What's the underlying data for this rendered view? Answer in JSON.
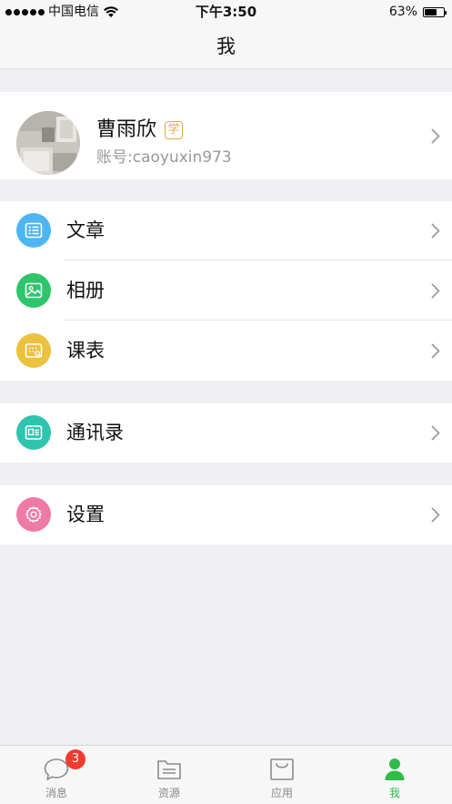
{
  "status_bar": {
    "carrier": "中国电信",
    "time": "下午3:50",
    "battery": "63%",
    "battery_level": 0.63
  },
  "nav": {
    "title": "我"
  },
  "profile": {
    "name": "曹雨欣",
    "role_badge": "学",
    "account": "账号:caoyuxin973"
  },
  "menu": {
    "articles": {
      "label": "文章",
      "icon": "article-icon",
      "color": "#4db5f2"
    },
    "album": {
      "label": "相册",
      "icon": "photo-album-icon",
      "color": "#2dc66b"
    },
    "schedule": {
      "label": "课表",
      "icon": "schedule-icon",
      "color": "#ecc13e"
    },
    "contacts": {
      "label": "通讯录",
      "icon": "contacts-card-icon",
      "color": "#2fc4ad"
    },
    "settings": {
      "label": "设置",
      "icon": "gear-icon",
      "color": "#f07aa6"
    }
  },
  "tab_bar": {
    "tabs": [
      {
        "label": "消息",
        "icon": "chat-bubble-icon",
        "badge": "3"
      },
      {
        "label": "资源",
        "icon": "folder-icon"
      },
      {
        "label": "应用",
        "icon": "shopping-bag-icon"
      },
      {
        "label": "我",
        "icon": "person-icon"
      }
    ],
    "active_tab": "我",
    "active_color": "#2fbd49"
  }
}
